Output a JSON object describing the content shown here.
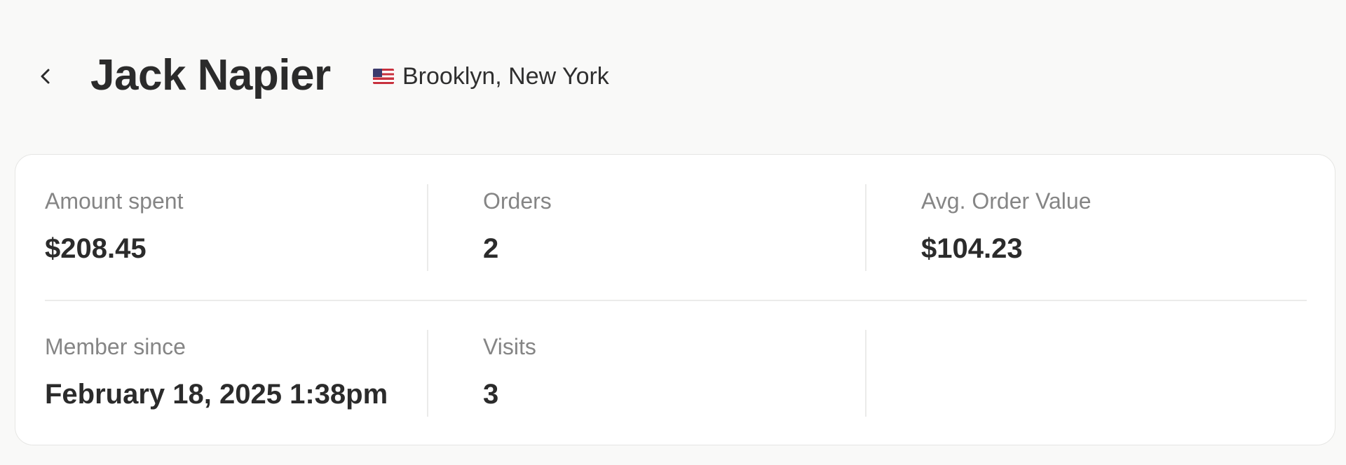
{
  "header": {
    "back_icon": "chevron-left-icon",
    "customer_name": "Jack Napier",
    "flag_icon": "us-flag-icon",
    "location": "Brooklyn, New York"
  },
  "stats": {
    "amount_spent": {
      "label": "Amount spent",
      "value": "$208.45"
    },
    "orders": {
      "label": "Orders",
      "value": "2"
    },
    "avg_order_value": {
      "label": "Avg. Order Value",
      "value": "$104.23"
    },
    "member_since": {
      "label": "Member since",
      "value": "February 18, 2025 1:38pm"
    },
    "visits": {
      "label": "Visits",
      "value": "3"
    }
  },
  "colors": {
    "page_background": "#f9f9f8",
    "card_background": "#ffffff",
    "label_text": "#858585",
    "value_text": "#2b2b2b",
    "divider": "#ebebea"
  }
}
